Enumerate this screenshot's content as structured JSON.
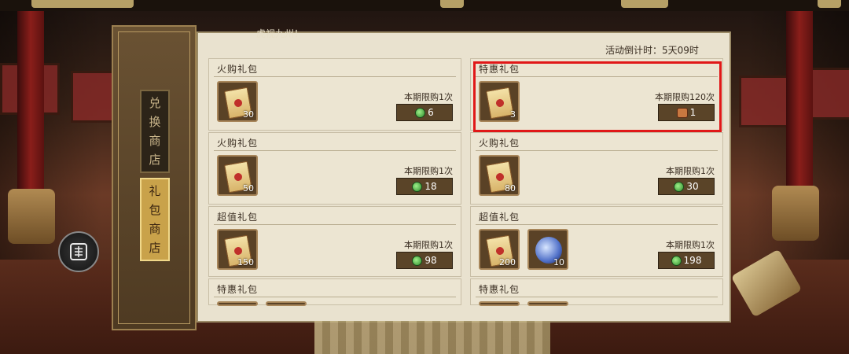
{
  "header": {
    "marquee": "虎视九州！",
    "countdown": "活动倒计时：5天09时"
  },
  "nav": {
    "tabs": [
      {
        "label": "兑换商店",
        "chars": [
          "兑",
          "换",
          "商",
          "店"
        ],
        "active": false
      },
      {
        "label": "礼包商店",
        "chars": [
          "礼",
          "包",
          "商",
          "店"
        ],
        "active": true
      }
    ],
    "seal_icon": "seal-menu-icon"
  },
  "packs": [
    {
      "title": "火购礼包",
      "items": [
        {
          "icon": "scroll-icon",
          "qty": "30"
        }
      ],
      "limit": "本期限购1次",
      "currency": "jade-icon",
      "price": "6"
    },
    {
      "title": "特惠礼包",
      "items": [
        {
          "icon": "scroll-icon",
          "qty": "3"
        }
      ],
      "limit": "本期限购120次",
      "currency": "token-icon",
      "price": "1"
    },
    {
      "title": "火购礼包",
      "items": [
        {
          "icon": "scroll-icon",
          "qty": "50"
        }
      ],
      "limit": "本期限购1次",
      "currency": "jade-icon",
      "price": "18"
    },
    {
      "title": "火购礼包",
      "items": [
        {
          "icon": "scroll-icon",
          "qty": "80"
        }
      ],
      "limit": "本期限购1次",
      "currency": "jade-icon",
      "price": "30"
    },
    {
      "title": "超值礼包",
      "items": [
        {
          "icon": "scroll-icon",
          "qty": "150"
        }
      ],
      "limit": "本期限购1次",
      "currency": "jade-icon",
      "price": "98"
    },
    {
      "title": "超值礼包",
      "items": [
        {
          "icon": "scroll-icon",
          "qty": "200"
        },
        {
          "icon": "orb-icon",
          "qty": "10"
        }
      ],
      "limit": "本期限购1次",
      "currency": "jade-icon",
      "price": "198"
    },
    {
      "title": "特惠礼包",
      "items": [],
      "limit": "",
      "currency": "",
      "price": ""
    },
    {
      "title": "特惠礼包",
      "items": [],
      "limit": "",
      "currency": "",
      "price": ""
    }
  ],
  "colors": {
    "highlight": "#e01818",
    "accent": "#c9a24a",
    "panel": "#e9e2cf"
  }
}
